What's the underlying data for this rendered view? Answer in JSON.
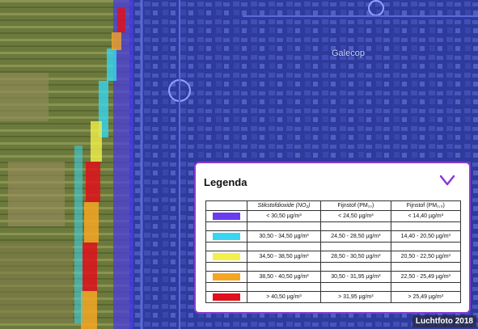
{
  "map": {
    "place_label": "Galecop",
    "photo_credit": "Luchtfoto 2018"
  },
  "legend": {
    "title": "Legenda",
    "toggle_icon": "chevron-down-icon",
    "columns": [
      "Stikstofdioxide (NO₂)",
      "Fijnstof (PM₁₀)",
      "Fijnstof (PM₂,₅)"
    ],
    "rows": [
      {
        "color": "#6a3cf0",
        "no2": "< 30,50 µg/m³",
        "pm10": "< 24,50 µg/m³",
        "pm25": "< 14,40 µg/m³"
      },
      {
        "color": "#38d6f0",
        "no2": "30,50 - 34,50 µg/m³",
        "pm10": "24,50 - 28,50 µg/m³",
        "pm25": "14,40 - 20,50 µg/m³"
      },
      {
        "color": "#f3f04a",
        "no2": "34,50 - 38,50 µg/m³",
        "pm10": "28,50 - 30,50 µg/m³",
        "pm25": "20,50 - 22,50 µg/m³"
      },
      {
        "color": "#f4a623",
        "no2": "38,50 - 40,50 µg/m³",
        "pm10": "30,50 - 31,95 µg/m³",
        "pm25": "22,50 - 25,49 µg/m³"
      },
      {
        "color": "#e0101c",
        "no2": "> 40,50 µg/m³",
        "pm10": "> 31,95 µg/m³",
        "pm25": "> 25,49 µg/m³"
      }
    ]
  }
}
